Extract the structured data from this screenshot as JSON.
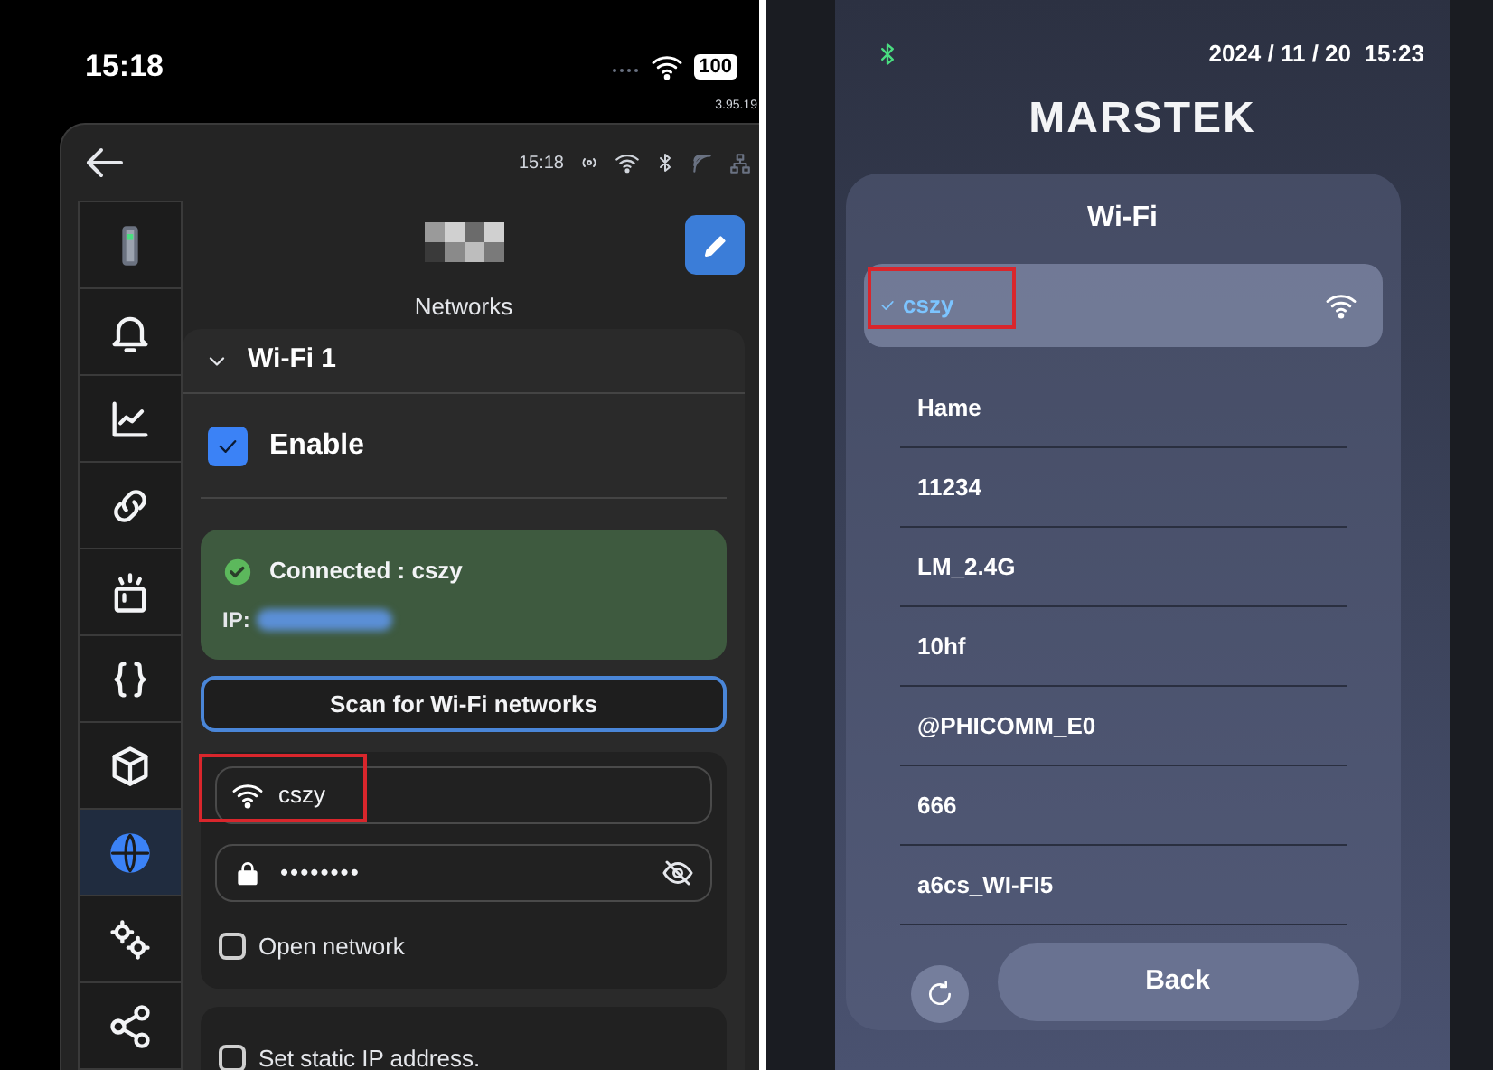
{
  "phone_status": {
    "time": "15:18",
    "battery": "100"
  },
  "version": "3.95.19",
  "app_header": {
    "time": "15:18"
  },
  "sidebar": {
    "items": [
      {
        "selected": false
      },
      {
        "selected": false
      },
      {
        "selected": false
      },
      {
        "selected": false
      },
      {
        "selected": false
      },
      {
        "selected": false
      },
      {
        "selected": false
      },
      {
        "selected": true
      },
      {
        "selected": false
      },
      {
        "selected": false
      }
    ]
  },
  "page_title": "Networks",
  "wifi_section": {
    "title": "Wi-Fi 1",
    "expanded": true,
    "enable": {
      "label": "Enable",
      "checked": true
    },
    "status": {
      "text": "Connected : cszy",
      "ip_label": "IP:"
    },
    "scan_button": "Scan for Wi-Fi networks",
    "ssid_field": {
      "value": "cszy"
    },
    "password_field": {
      "value": "••••••••"
    },
    "open_network": {
      "label": "Open network",
      "checked": false
    }
  },
  "static_ip": {
    "label": "Set static IP address.",
    "checked": false
  },
  "device": {
    "date_time": "2024 / 11 / 20  15:23",
    "brand": "MARSTEK",
    "title": "Wi-Fi",
    "networks": [
      {
        "name": "cszy",
        "selected": true
      },
      {
        "name": "Hame",
        "selected": false
      },
      {
        "name": "11234",
        "selected": false
      },
      {
        "name": "LM_2.4G",
        "selected": false
      },
      {
        "name": "10hf",
        "selected": false
      },
      {
        "name": "@PHICOMM_E0",
        "selected": false
      },
      {
        "name": "666",
        "selected": false
      },
      {
        "name": "a6cs_WI-FI5",
        "selected": false
      }
    ],
    "back_button": "Back"
  }
}
